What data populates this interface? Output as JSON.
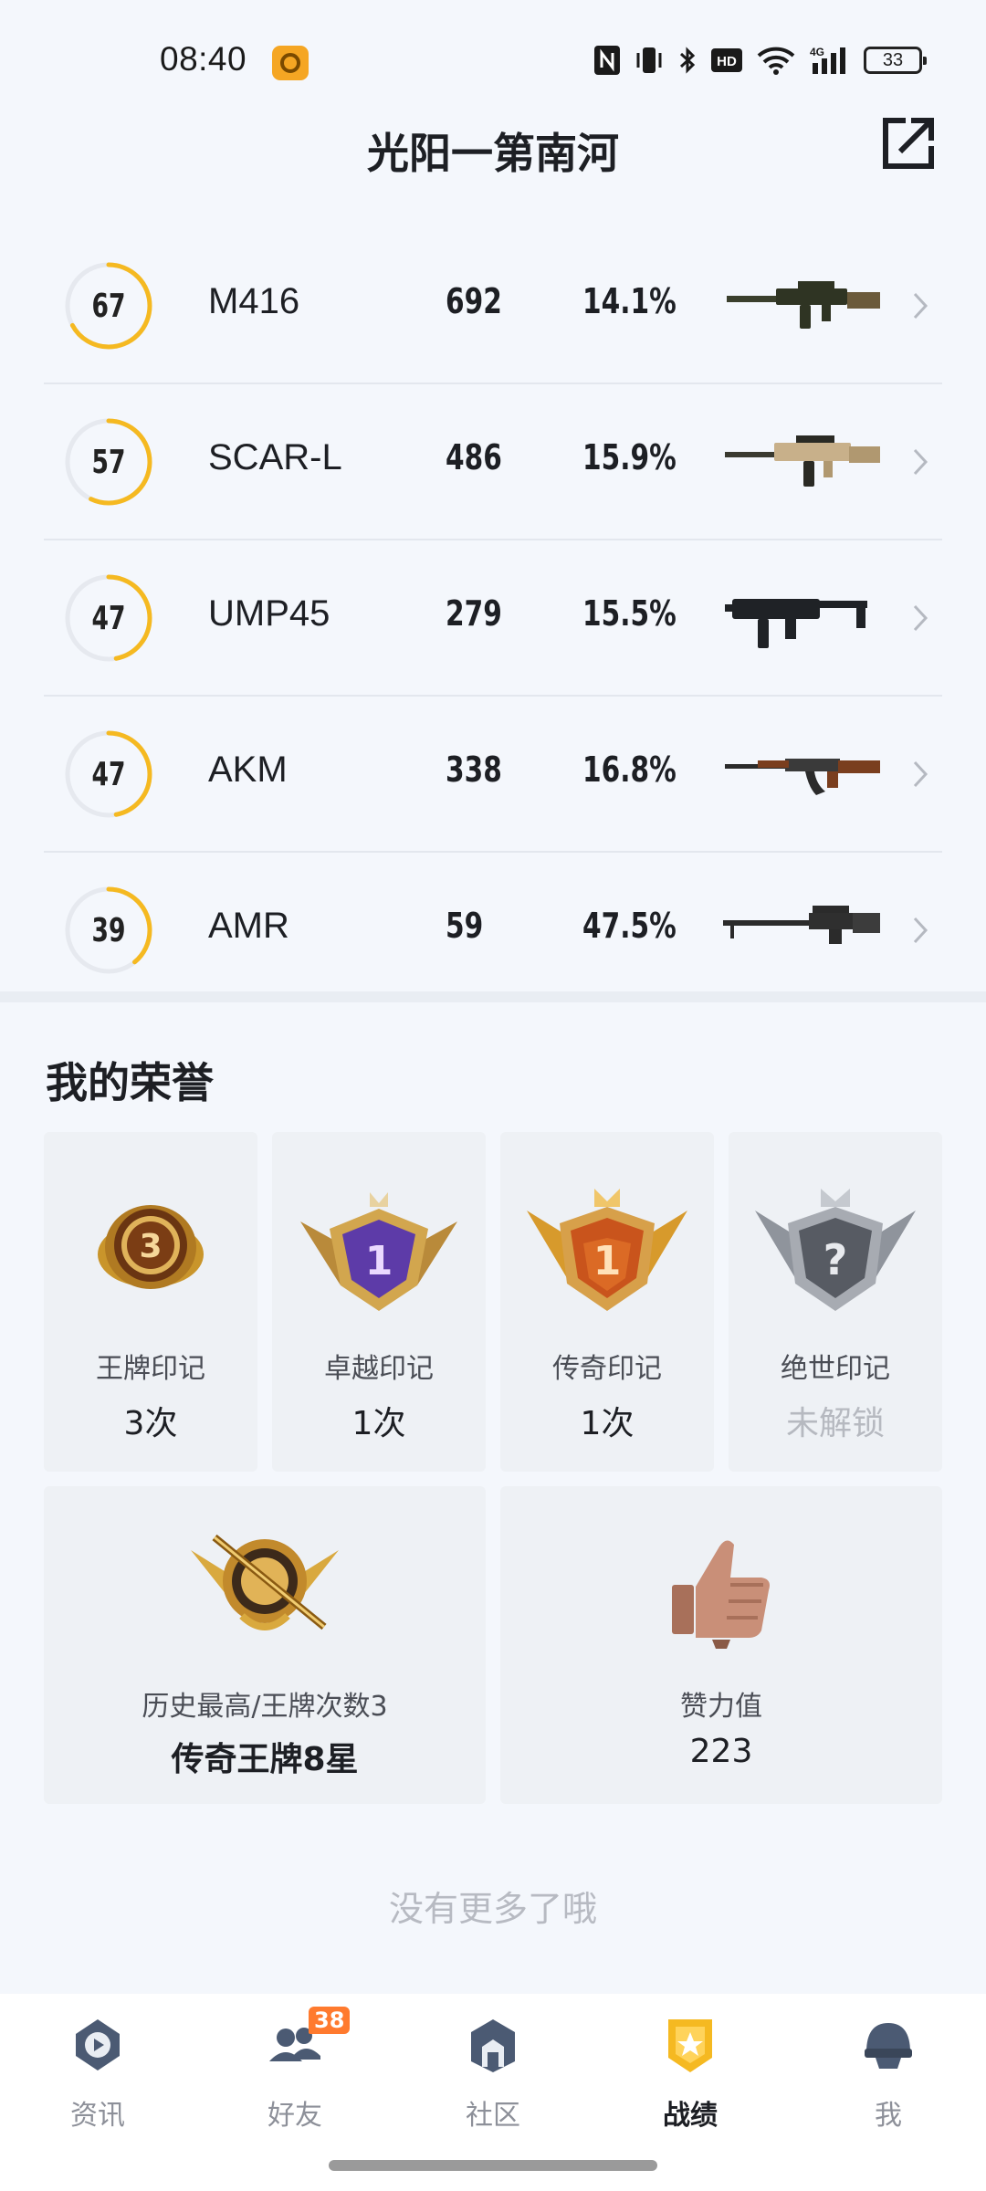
{
  "status_bar": {
    "time": "08:40",
    "battery": "33",
    "network": "4G"
  },
  "header": {
    "title": "光阳一第南河"
  },
  "weapons": [
    {
      "score": "67",
      "name": "M416",
      "kills": "692",
      "rate": "14.1%",
      "progress": 0.67,
      "icon": "m416-rifle-icon"
    },
    {
      "score": "57",
      "name": "SCAR-L",
      "kills": "486",
      "rate": "15.9%",
      "progress": 0.57,
      "icon": "scarl-rifle-icon"
    },
    {
      "score": "47",
      "name": "UMP45",
      "kills": "279",
      "rate": "15.5%",
      "progress": 0.47,
      "icon": "ump45-smg-icon"
    },
    {
      "score": "47",
      "name": "AKM",
      "kills": "338",
      "rate": "16.8%",
      "progress": 0.47,
      "icon": "akm-rifle-icon"
    },
    {
      "score": "39",
      "name": "AMR",
      "kills": "59",
      "rate": "47.5%",
      "progress": 0.39,
      "icon": "amr-sniper-icon"
    }
  ],
  "honors": {
    "title": "我的荣誉",
    "marks": [
      {
        "label": "王牌印记",
        "value": "3次",
        "badge_number": "3",
        "icon": "ace-mark-badge-icon"
      },
      {
        "label": "卓越印记",
        "value": "1次",
        "badge_number": "1",
        "icon": "excellence-mark-badge-icon"
      },
      {
        "label": "传奇印记",
        "value": "1次",
        "badge_number": "1",
        "icon": "legend-mark-badge-icon"
      },
      {
        "label": "绝世印记",
        "value": "未解锁",
        "badge_number": "?",
        "icon": "peerless-mark-badge-icon",
        "locked": true
      }
    ],
    "highest": {
      "label": "历史最高/王牌次数3",
      "value": "传奇王牌8星",
      "icon": "legend-ace-rank-badge-icon"
    },
    "likes": {
      "label": "赞力值",
      "value": "223",
      "icon": "thumbs-up-icon"
    }
  },
  "footer_text": "没有更多了哦",
  "tabs": [
    {
      "label": "资讯",
      "icon": "news-icon"
    },
    {
      "label": "好友",
      "icon": "friends-icon",
      "badge": "38"
    },
    {
      "label": "社区",
      "icon": "community-icon"
    },
    {
      "label": "战绩",
      "icon": "record-icon",
      "active": true
    },
    {
      "label": "我",
      "icon": "profile-helmet-icon"
    }
  ],
  "colors": {
    "accent_yellow": "#f5b921",
    "background": "#f4f7fc",
    "card": "#eef1f5",
    "badge_orange": "#ff7a2e"
  }
}
